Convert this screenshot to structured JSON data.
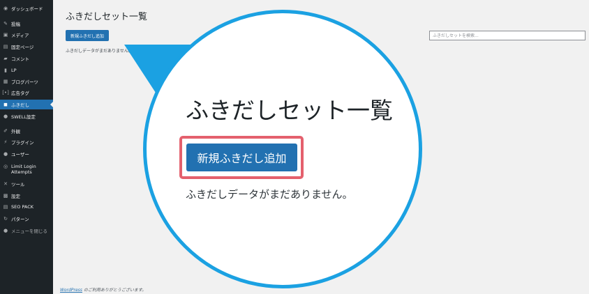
{
  "sidebar": {
    "items": [
      {
        "label": "ダッシュボード",
        "icon": "dashboard-icon",
        "glyph": "◉"
      },
      {
        "label": "投稿",
        "icon": "pin-icon",
        "glyph": "✎"
      },
      {
        "label": "メディア",
        "icon": "media-icon",
        "glyph": "▣"
      },
      {
        "label": "固定ページ",
        "icon": "page-icon",
        "glyph": "▤"
      },
      {
        "label": "コメント",
        "icon": "comment-icon",
        "glyph": "▰"
      },
      {
        "label": "LP",
        "icon": "lp-icon",
        "glyph": "▮"
      },
      {
        "label": "ブログパーツ",
        "icon": "blog-parts-icon",
        "glyph": "▦"
      },
      {
        "label": "広告タグ",
        "icon": "ad-tag-icon",
        "glyph": "[•]"
      },
      {
        "label": "ふきだし",
        "icon": "speech-bubble-icon",
        "glyph": "◼"
      },
      {
        "label": "SWELL設定",
        "icon": "swell-icon",
        "glyph": "●"
      },
      {
        "label": "外観",
        "icon": "appearance-icon",
        "glyph": "✐"
      },
      {
        "label": "プラグイン",
        "icon": "plugin-icon",
        "glyph": "⚡"
      },
      {
        "label": "ユーザー",
        "icon": "user-icon",
        "glyph": "●"
      },
      {
        "label": "Limit Login Attempts",
        "icon": "limit-login-icon",
        "glyph": "◎"
      },
      {
        "label": "ツール",
        "icon": "tools-icon",
        "glyph": "✕"
      },
      {
        "label": "設定",
        "icon": "settings-icon",
        "glyph": "▩"
      },
      {
        "label": "SEO PACK",
        "icon": "seo-pack-icon",
        "glyph": "▤"
      },
      {
        "label": "パターン",
        "icon": "pattern-icon",
        "glyph": "↻"
      },
      {
        "label": "メニューを閉じる",
        "icon": "collapse-menu-icon",
        "glyph": "●"
      }
    ]
  },
  "main": {
    "title": "ふきだしセット一覧",
    "add_button_label": "新規ふきだし追加",
    "empty_message": "ふきだしデータがまだありません。",
    "search_placeholder": "ふきだしセットを検索..."
  },
  "footer": {
    "link_text": "WordPress",
    "text": " のご利用ありがとうございます。"
  },
  "zoom": {
    "title": "ふきだしセット一覧",
    "button_label": "新規ふきだし追加",
    "empty_message": "ふきだしデータがまだありません。"
  },
  "colors": {
    "accent": "#2271b1",
    "callout": "#1ba1e2",
    "highlight": "#e4606d",
    "sidebar_bg": "#1d2327"
  }
}
